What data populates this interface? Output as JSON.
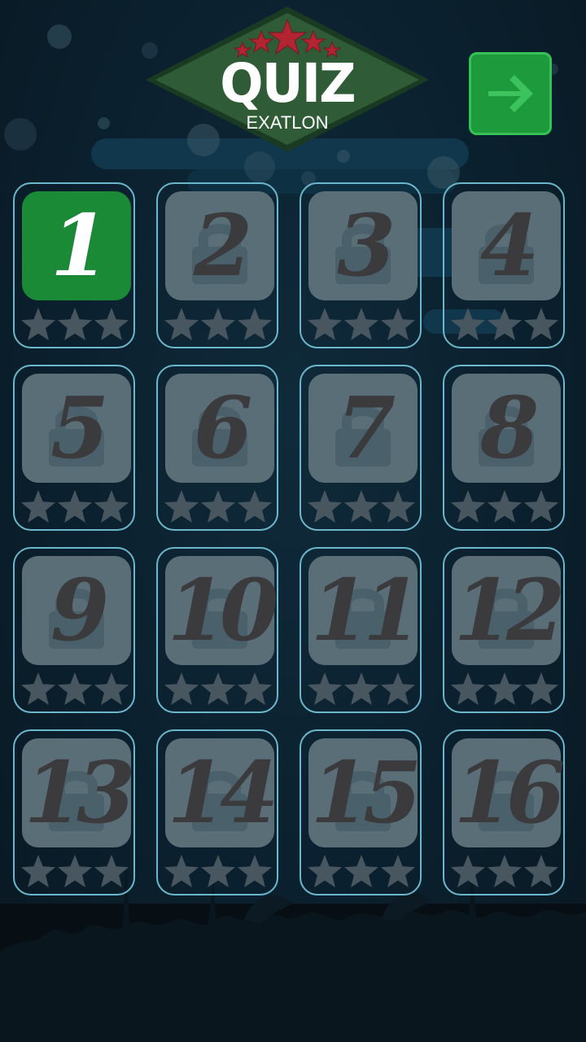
{
  "header": {
    "title": "QUIZ",
    "subtitle": "EXATLON",
    "next_button_icon": "arrow-right-icon"
  },
  "colors": {
    "accent_green": "#1c9a3c",
    "tile_locked": "#5a6e78",
    "card_border": "#6bb7cc",
    "logo_red": "#b32432",
    "logo_green": "#2f5b36"
  },
  "levels": [
    {
      "number": "1",
      "unlocked": true,
      "stars_earned": 0
    },
    {
      "number": "2",
      "unlocked": false,
      "stars_earned": 0
    },
    {
      "number": "3",
      "unlocked": false,
      "stars_earned": 0
    },
    {
      "number": "4",
      "unlocked": false,
      "stars_earned": 0
    },
    {
      "number": "5",
      "unlocked": false,
      "stars_earned": 0
    },
    {
      "number": "6",
      "unlocked": false,
      "stars_earned": 0
    },
    {
      "number": "7",
      "unlocked": false,
      "stars_earned": 0
    },
    {
      "number": "8",
      "unlocked": false,
      "stars_earned": 0
    },
    {
      "number": "9",
      "unlocked": false,
      "stars_earned": 0
    },
    {
      "number": "10",
      "unlocked": false,
      "stars_earned": 0
    },
    {
      "number": "11",
      "unlocked": false,
      "stars_earned": 0
    },
    {
      "number": "12",
      "unlocked": false,
      "stars_earned": 0
    },
    {
      "number": "13",
      "unlocked": false,
      "stars_earned": 0
    },
    {
      "number": "14",
      "unlocked": false,
      "stars_earned": 0
    },
    {
      "number": "15",
      "unlocked": false,
      "stars_earned": 0
    },
    {
      "number": "16",
      "unlocked": false,
      "stars_earned": 0
    }
  ],
  "stars_per_level": 3
}
